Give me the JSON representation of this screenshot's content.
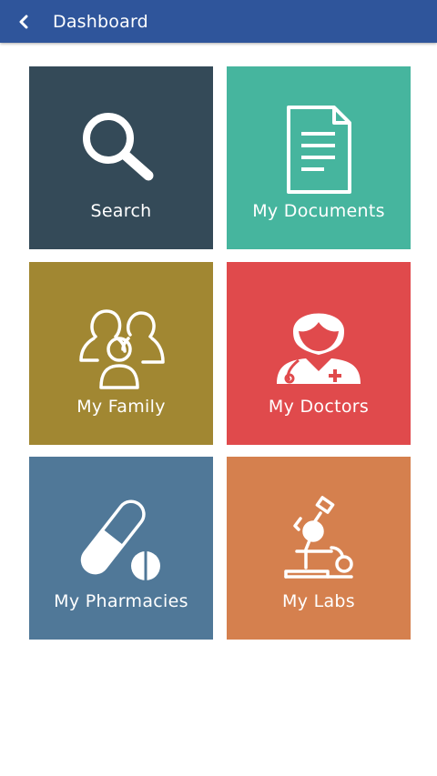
{
  "header": {
    "title": "Dashboard",
    "back_icon": "chevron-left-icon",
    "background": "#2f559b"
  },
  "tiles": [
    {
      "label": "Search",
      "icon": "search-icon",
      "color": "#344a58"
    },
    {
      "label": "My Documents",
      "icon": "document-icon",
      "color": "#46b59e"
    },
    {
      "label": "My Family",
      "icon": "family-icon",
      "color": "#a18732"
    },
    {
      "label": "My Doctors",
      "icon": "doctor-icon",
      "color": "#e04a4c"
    },
    {
      "label": "My Pharmacies",
      "icon": "pill-icon",
      "color": "#507898"
    },
    {
      "label": "My Labs",
      "icon": "microscope-icon",
      "color": "#d5804e"
    }
  ]
}
